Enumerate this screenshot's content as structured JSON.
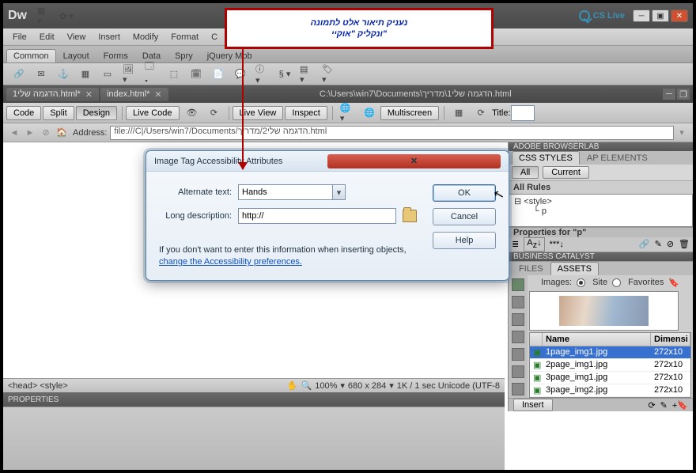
{
  "annotation": {
    "line1": "נעניק תיאור אלט לתמונה",
    "line2": "ונקליק \"אוקיי\""
  },
  "appbar": {
    "logo": "Dw",
    "cslive": "CS Live"
  },
  "menu": [
    "File",
    "Edit",
    "View",
    "Insert",
    "Modify",
    "Format",
    "C"
  ],
  "cat_tabs": [
    "Common",
    "Layout",
    "Forms",
    "Data",
    "Spry",
    "jQuery Mob"
  ],
  "doc_tabs": [
    {
      "label": "הדגמה שלי1.html*"
    },
    {
      "label": "index.html*"
    }
  ],
  "doc_path": "C:\\Users\\win7\\Documents\\הדגמה שלי1\\מדריך.html",
  "viewbar": {
    "code": "Code",
    "split": "Split",
    "design": "Design",
    "livecode": "Live Code",
    "liveview": "Live View",
    "inspect": "Inspect",
    "multiscreen": "Multiscreen",
    "title": "Title:"
  },
  "addr": {
    "label": "Address:",
    "value": "file:///C|/Users/win7/Documents/הדגמה שלי2/מדריך.html"
  },
  "dialog": {
    "title": "Image Tag Accessibility Attributes",
    "alt_label": "Alternate text:",
    "alt_value": "Hands",
    "long_label": "Long description:",
    "long_value": "http://",
    "note_1": "If you don't want to enter this information when inserting objects, ",
    "note_link": "change the Accessibility preferences.",
    "ok": "OK",
    "cancel": "Cancel",
    "help": "Help"
  },
  "panels": {
    "browserlab": "ADOBE BROWSERLAB",
    "css_tab": "CSS STYLES",
    "ap_tab": "AP ELEMENTS",
    "all": "All",
    "current": "Current",
    "allrules": "All Rules",
    "rule1": "<style>",
    "rule2": "p",
    "props_for": "Properties for \"p\"",
    "biz": "BUSINESS CATALYST",
    "files": "FILES",
    "assets": "ASSETS",
    "images": "Images:",
    "site": "Site",
    "fav": "Favorites",
    "th_name": "Name",
    "th_dim": "Dimensi",
    "rows": [
      {
        "n": "1page_img1.jpg",
        "d": "272x10"
      },
      {
        "n": "2page_img1.jpg",
        "d": "272x10"
      },
      {
        "n": "3page_img1.jpg",
        "d": "272x10"
      },
      {
        "n": "3page_img2.jpg",
        "d": "272x10"
      }
    ],
    "insert": "Insert"
  },
  "status": {
    "left": "<head> <style>",
    "zoom": "100%",
    "dims": "680 x 284",
    "rest": "1K / 1 sec Unicode (UTF-8"
  },
  "props_panel": "PROPERTIES"
}
